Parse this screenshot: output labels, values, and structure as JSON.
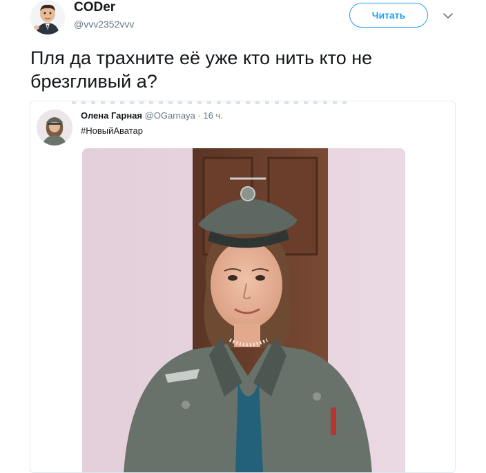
{
  "tweet": {
    "author_name": "CODer",
    "author_handle": "@vvv2352vvv",
    "follow_label": "Читать",
    "text": "Пля да трахните её уже кто нить кто не\nбрезгливый а?"
  },
  "quoted_tweet": {
    "author_name": "Олена Гарная",
    "author_handle": "@OGarnaya",
    "separator": "·",
    "time": "16 ч.",
    "text": "#НовыйАватар"
  },
  "icons": {
    "more": "chevron-down-icon"
  },
  "colors": {
    "accent": "#1da1f2",
    "text": "#14171a",
    "secondary_text": "#657786",
    "border": "#e1e8ed"
  }
}
